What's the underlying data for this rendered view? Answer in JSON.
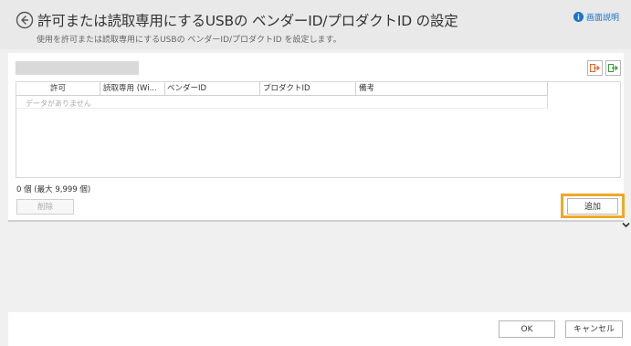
{
  "header": {
    "title": "許可または読取専用にするUSBの ベンダーID/プロダクトID の設定",
    "subtitle": "使用を許可または読取専用にするUSBの ベンダーID/プロダクトID を設定します。",
    "help_label": "画面説明"
  },
  "table": {
    "columns": [
      "許可",
      "読取専用 (Wi...",
      "ベンダーID",
      "プロダクトID",
      "備考"
    ],
    "empty_message": "データがありません"
  },
  "count_text": "0 個 (最大 9,999 個)",
  "buttons": {
    "delete": "削除",
    "add": "追加",
    "ok": "OK",
    "cancel": "キャンセル"
  },
  "icons": {
    "back": "back-arrow-circle-icon",
    "help": "info-icon",
    "import": "import-icon",
    "export": "export-icon",
    "collapse": "chevron-down-icon"
  },
  "colors": {
    "help_link": "#1a73c9",
    "highlight": "#f0a825",
    "import_icon": "#e8652a",
    "export_icon": "#3a9a3a"
  }
}
